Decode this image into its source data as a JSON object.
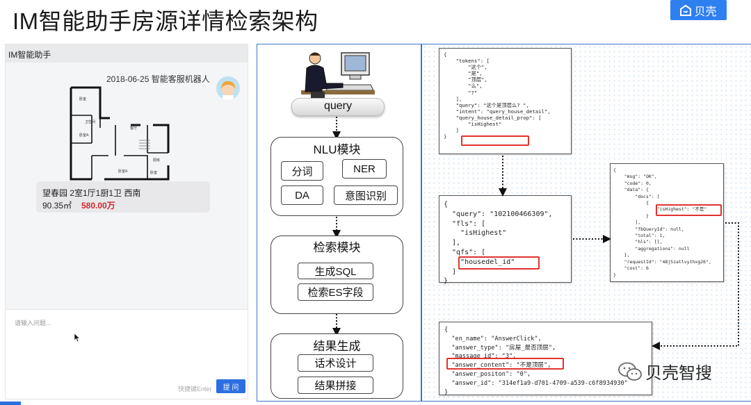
{
  "slide": {
    "title": "IM智能助手房源详情检索架构",
    "logo_text": "贝壳"
  },
  "phone": {
    "header": "IM智能助手",
    "bot_line": "2018-06-25 智能客服机器人",
    "listing": {
      "name": "望春园   2室1厅1厨1卫   西南",
      "area": "90.35㎡",
      "price": "580.00万"
    },
    "input_placeholder": "请输入问题...",
    "shortcut_hint": "快捷键Enter",
    "send_label": "提 问"
  },
  "flow": {
    "query_label": "query",
    "nlu": {
      "title": "NLU模块",
      "items": [
        "分词",
        "NER",
        "DA",
        "意图识别"
      ]
    },
    "search": {
      "title": "检索模块",
      "items": [
        "生成SQL",
        "检索ES字段"
      ]
    },
    "result": {
      "title": "结果生成",
      "items": [
        "话术设计",
        "结果拼接"
      ]
    }
  },
  "json_blocks": {
    "nlu_output": "{\n    \"tokens\": [\n        \"这个\",\n        \"是\",\n        \"顶层\",\n        \"么\",\n        \"?\"\n    ],\n    \"query\": \"这个是顶层么? \",\n    \"intent\": \"query_house_detail\",\n    \"query_house_detail_prop\": [\n        \"isHighest\"\n    ]\n}",
    "search_request": "{\n  \"query\": \"102100466309\",\n  \"fls\": [\n    \"isHighest\"\n  ],\n  \"qfs\": [\n    \"housedel_id\"\n  ]\n}",
    "search_response": "{\n    \"msg\": \"OK\",\n    \"code\": 0,\n    \"data\": {\n        \"docs\": [\n            {\n                \"isHighest\": \"不是\"\n            }\n        ],\n        \"fbQueryId\": null,\n        \"total\": 1,\n        \"hls\": [],\n        \"aggregations\": null\n    },\n    \"requestId\": \"48j5zatlvythxg26\",\n    \"cost\": 6\n}",
    "answer_output": "{\n  \"en_name\": \"AnswerClick\",\n  \"answer_type\": \"房屋_是否顶层\",\n  \"massage_id\": \"3\",\n  \"answer_content\": \"不是顶层\",\n  \"answer_positon\": \"0\",\n  \"answer_id\": \"314ef1a9-d701-4709-a539-c6f8934930\"\n}"
  },
  "watermark": "贝壳智搜",
  "colors": {
    "accent": "#2e7ff0",
    "panel_border": "#3c74c8",
    "highlight": "#e0332d",
    "price": "#d0262e"
  }
}
